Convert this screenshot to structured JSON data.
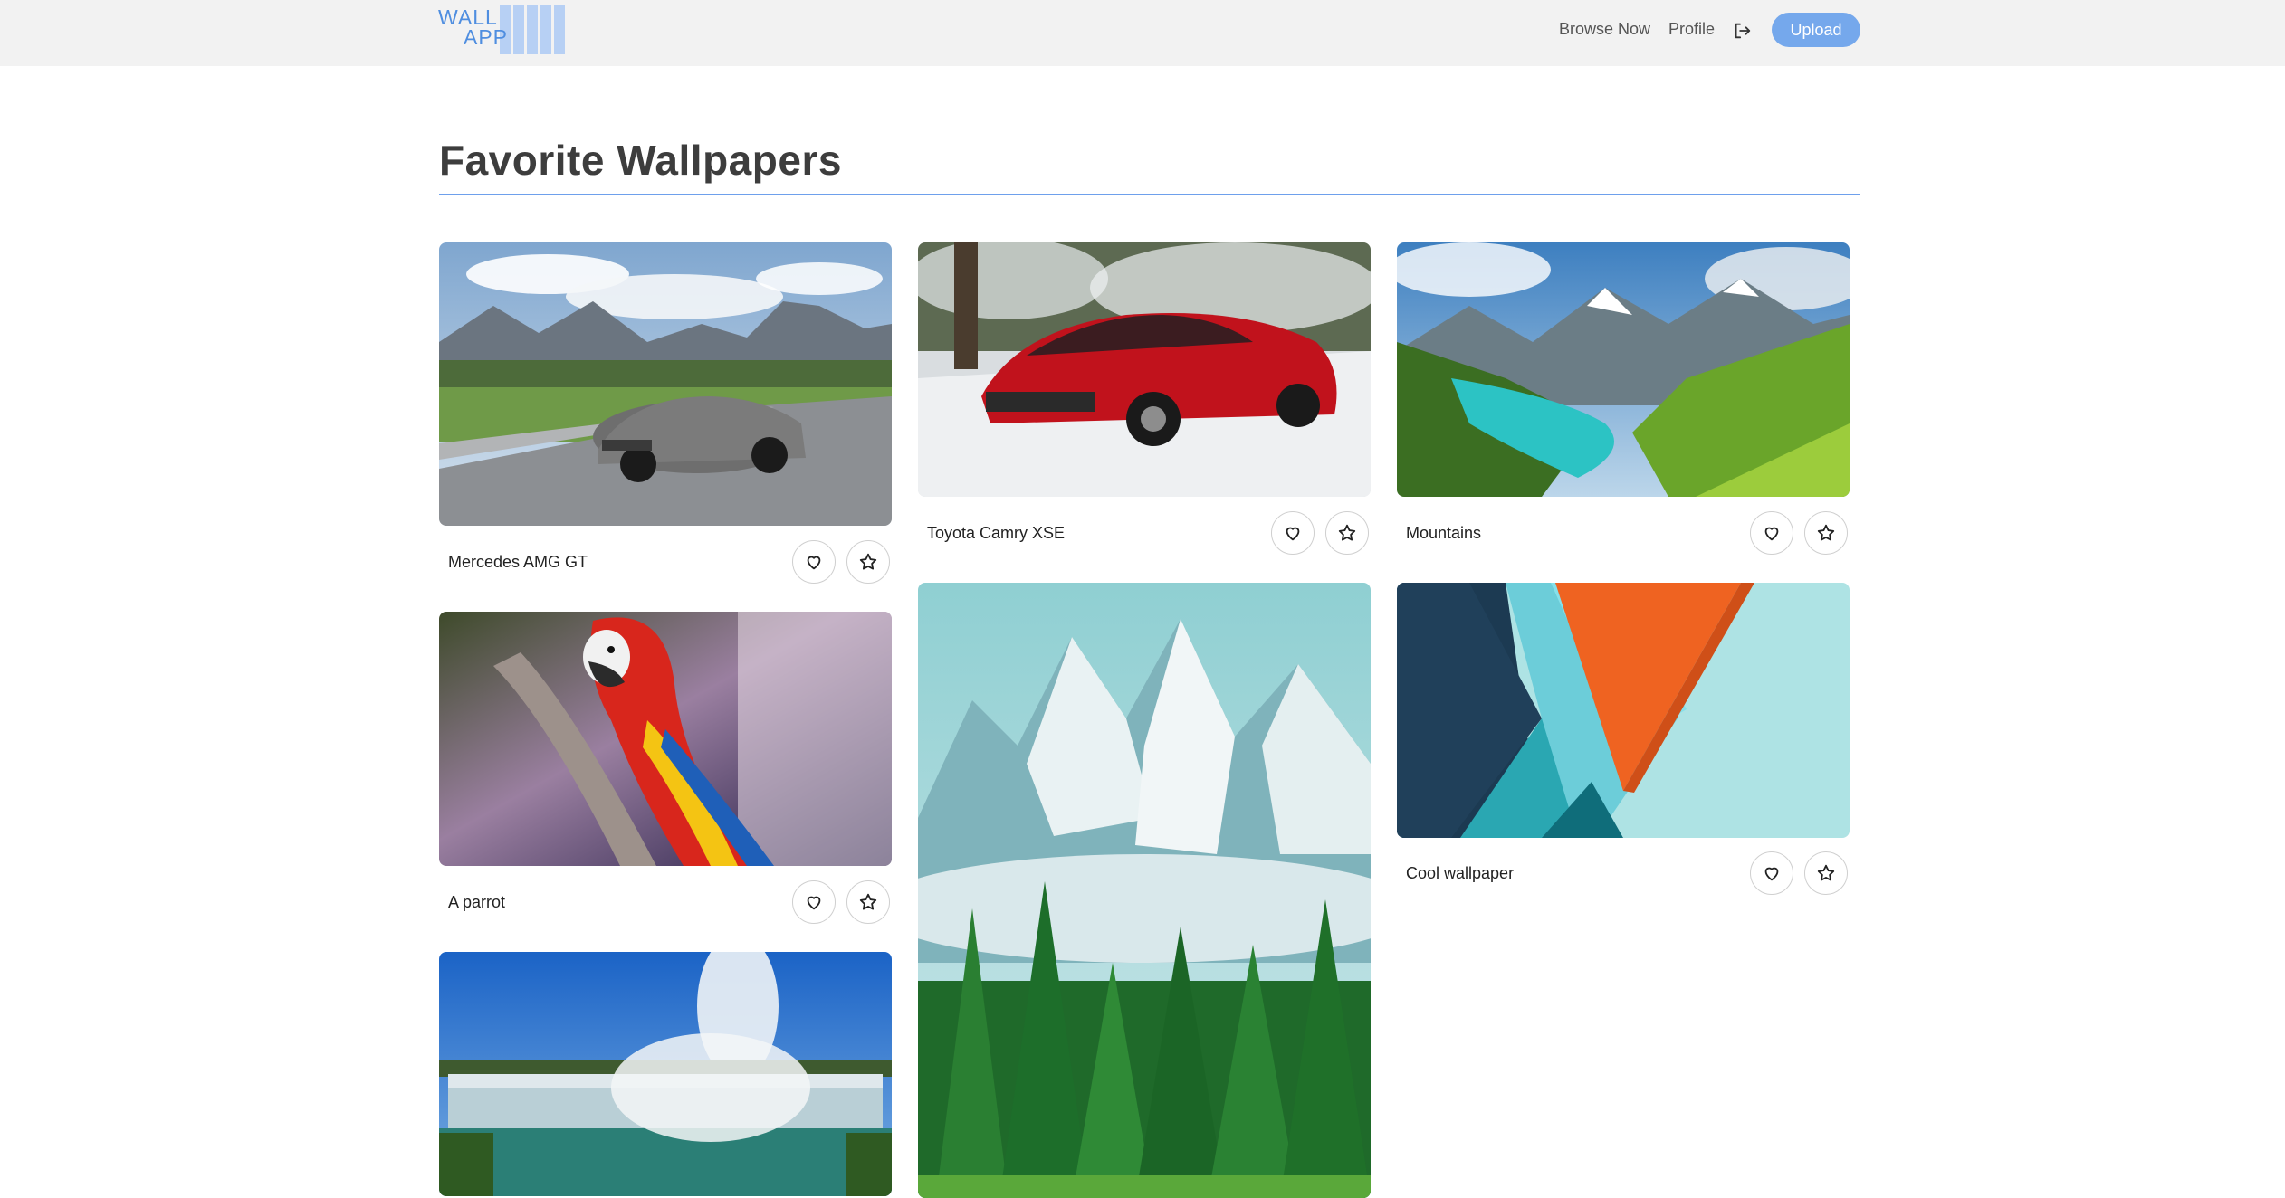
{
  "brand": {
    "line1": "WALL",
    "line2": "APP"
  },
  "nav": {
    "browse_label": "Browse Now",
    "profile_label": "Profile",
    "logout_icon": "logout-icon",
    "upload_label": "Upload"
  },
  "page": {
    "title": "Favorite Wallpapers"
  },
  "colors": {
    "accent": "#75a8ec",
    "rule": "#6ea0ec",
    "header_bg": "#f2f2f2",
    "logo": "#4f8ee0"
  },
  "wallpapers": [
    {
      "title": "Mercedes AMG GT",
      "image": "silver sports car on mountain road"
    },
    {
      "title": "Toyota Camry XSE",
      "image": "red sedan in snowy forest"
    },
    {
      "title": "Mountains",
      "image": "turquoise lake in green mountain valley"
    },
    {
      "title": "A parrot",
      "image": "scarlet macaw on a branch"
    },
    {
      "title": "",
      "image": "snowy mountain peaks above pine forest"
    },
    {
      "title": "Cool wallpaper",
      "image": "abstract geometric teal and orange shapes"
    },
    {
      "title": "",
      "image": "waterfall with mist under blue sky"
    }
  ],
  "card_actions": {
    "like_icon": "heart-icon",
    "favorite_icon": "star-icon"
  }
}
